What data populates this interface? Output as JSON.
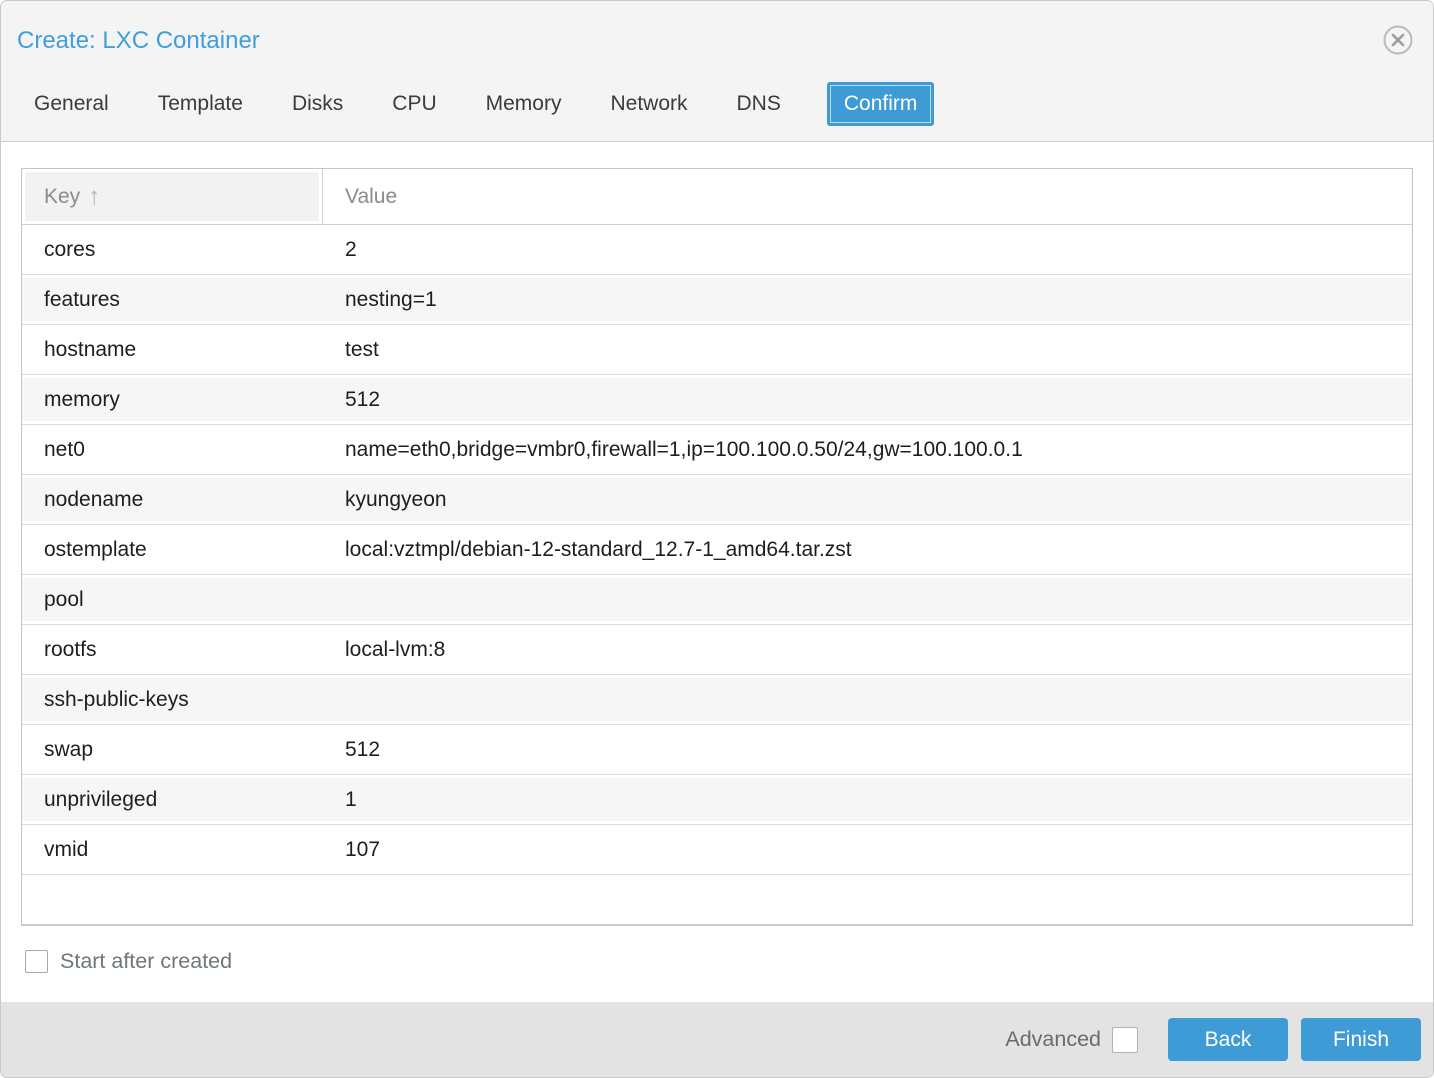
{
  "window": {
    "title": "Create: LXC Container"
  },
  "tabs": [
    {
      "label": "General",
      "active": false
    },
    {
      "label": "Template",
      "active": false
    },
    {
      "label": "Disks",
      "active": false
    },
    {
      "label": "CPU",
      "active": false
    },
    {
      "label": "Memory",
      "active": false
    },
    {
      "label": "Network",
      "active": false
    },
    {
      "label": "DNS",
      "active": false
    },
    {
      "label": "Confirm",
      "active": true
    }
  ],
  "grid": {
    "columns": [
      "Key",
      "Value"
    ],
    "sort_icon": "↑",
    "rows": [
      {
        "key": "cores",
        "value": "2"
      },
      {
        "key": "features",
        "value": "nesting=1"
      },
      {
        "key": "hostname",
        "value": "test"
      },
      {
        "key": "memory",
        "value": "512"
      },
      {
        "key": "net0",
        "value": "name=eth0,bridge=vmbr0,firewall=1,ip=100.100.0.50/24,gw=100.100.0.1"
      },
      {
        "key": "nodename",
        "value": "kyungyeon"
      },
      {
        "key": "ostemplate",
        "value": "local:vztmpl/debian-12-standard_12.7-1_amd64.tar.zst"
      },
      {
        "key": "pool",
        "value": ""
      },
      {
        "key": "rootfs",
        "value": "local-lvm:8"
      },
      {
        "key": "ssh-public-keys",
        "value": ""
      },
      {
        "key": "swap",
        "value": "512"
      },
      {
        "key": "unprivileged",
        "value": "1"
      },
      {
        "key": "vmid",
        "value": "107"
      }
    ]
  },
  "start_checkbox": {
    "label": "Start after created",
    "checked": false
  },
  "footer": {
    "advanced_label": "Advanced",
    "advanced_checked": false,
    "back_label": "Back",
    "finish_label": "Finish"
  },
  "colors": {
    "accent_blue": "#3f9bd5",
    "title_blue": "#3f9edc",
    "header_bg": "#f4f4f4",
    "footer_bg": "#e3e3e3",
    "row_alt_bg": "#f6f6f6",
    "text_dark": "#1e1e1e",
    "text_gray": "#8b8b8b"
  }
}
